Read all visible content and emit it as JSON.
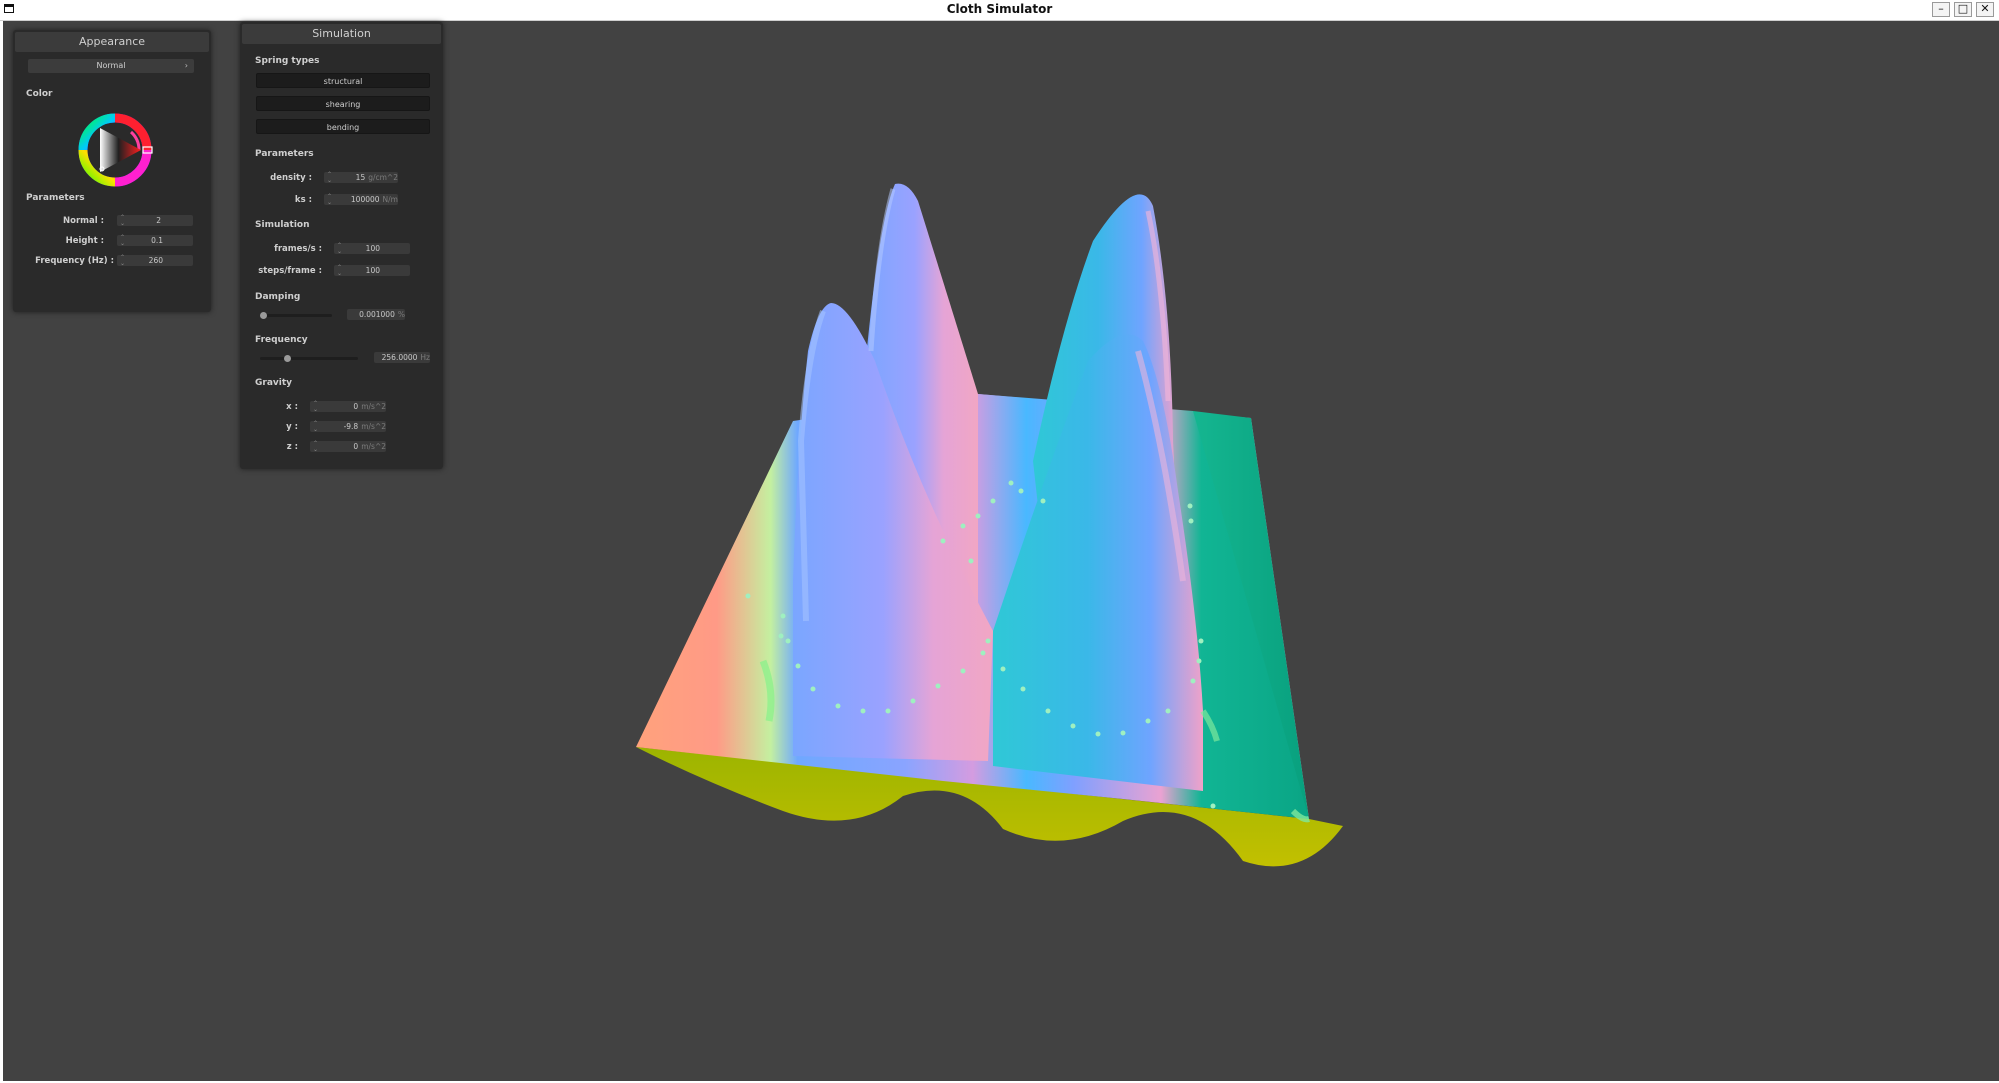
{
  "window": {
    "title": "Cloth Simulator",
    "minimize_glyph": "–",
    "maximize_glyph": "□",
    "close_glyph": "✕"
  },
  "appearance": {
    "header": "Appearance",
    "shader_selected": "Normal",
    "color_section": "Color",
    "parameters_section": "Parameters",
    "normal_label": "Normal :",
    "normal_value": "2",
    "height_label": "Height :",
    "height_value": "0.1",
    "frequency_label": "Frequency (Hz) :",
    "frequency_value": "260"
  },
  "simulation": {
    "header": "Simulation",
    "spring_types_section": "Spring types",
    "spring_types": [
      "structural",
      "shearing",
      "bending"
    ],
    "parameters_section": "Parameters",
    "density_label": "density :",
    "density_value": "15",
    "density_unit": "g/cm^2",
    "ks_label": "ks :",
    "ks_value": "100000",
    "ks_unit": "N/m",
    "simulation_section": "Simulation",
    "fps_label": "frames/s :",
    "fps_value": "100",
    "steps_label": "steps/frame :",
    "steps_value": "100",
    "damping_section": "Damping",
    "damping_value": "0.001000",
    "damping_unit": "%",
    "damping_fraction": 0.0,
    "frequency_section": "Frequency",
    "frequency_value": "256.0000",
    "frequency_unit": "Hz",
    "frequency_fraction": 0.26,
    "gravity_section": "Gravity",
    "gx_label": "x :",
    "gx_value": "0",
    "gy_label": "y :",
    "gy_value": "-9.8",
    "gz_label": "z :",
    "gz_value": "0",
    "gravity_unit": "m/s^2"
  },
  "colors": {
    "viewport_bg": "#424242",
    "panel_bg": "#2a2a2a",
    "cloth_pink": "#e6a0d8",
    "cloth_blue": "#6fa0ff",
    "cloth_teal": "#12b08a",
    "cloth_orange": "#ff9a7a",
    "cloth_underside": "#a8b800",
    "particle": "#9ff0c0"
  },
  "icons": {
    "window_icon": "window-icon",
    "color_wheel": "color-wheel-icon",
    "dropdown_caret": "chevron-down-icon"
  }
}
